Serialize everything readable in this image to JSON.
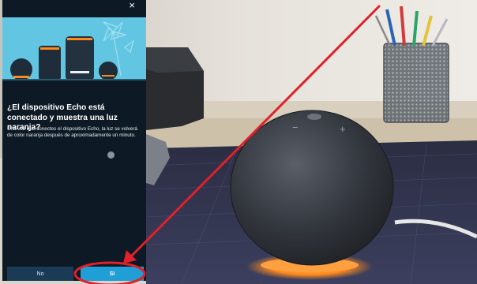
{
  "phone_screen": {
    "close_glyph": "×",
    "question_title": "¿El dispositivo Echo está conectado y muestra una luz naranja?",
    "question_body": "Una vez que conectes el dispositivo Echo, la luz se volverá de color naranja después de aproximadamente un minuto.",
    "buttons": {
      "no_label": "No",
      "yes_label": "Sí"
    },
    "icons": {
      "close": "close-icon",
      "hero": "echo-devices-illustration",
      "spinner": "loading-dot-icon"
    }
  },
  "colors": {
    "screen_background": "#0d1a25",
    "hero_background": "#62c6e3",
    "primary_button": "#1f9fd6",
    "secondary_button": "#1a3a55",
    "annotation_red": "#e0202a",
    "echo_light_ring": "#ff8a1e"
  }
}
